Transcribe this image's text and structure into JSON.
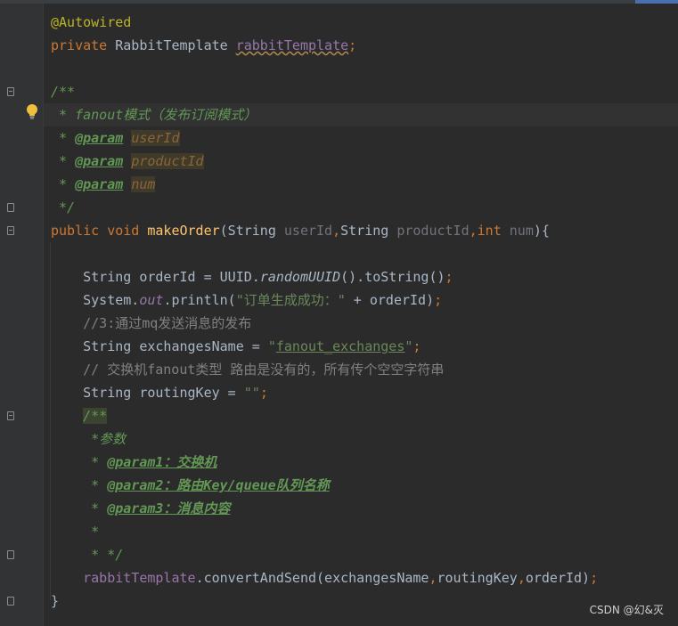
{
  "editor": {
    "lines": [
      {
        "spans": [
          {
            "t": "@Autowired",
            "c": "ann"
          }
        ]
      },
      {
        "spans": [
          {
            "t": "private ",
            "c": "kw"
          },
          {
            "t": "RabbitTemplate ",
            "c": ""
          },
          {
            "t": "rabbitTemplate",
            "c": "field wavy"
          },
          {
            "t": ";",
            "c": "kw"
          }
        ]
      },
      {
        "spans": []
      },
      {
        "spans": [
          {
            "t": "/**",
            "c": "doc"
          }
        ]
      },
      {
        "spans": [
          {
            "t": " * fanout模式（发布订阅模式）",
            "c": "doc"
          }
        ]
      },
      {
        "spans": [
          {
            "t": " * ",
            "c": "doc"
          },
          {
            "t": "@param",
            "c": "doctag"
          },
          {
            "t": " ",
            "c": "doc"
          },
          {
            "t": "userId",
            "c": "docval"
          }
        ]
      },
      {
        "spans": [
          {
            "t": " * ",
            "c": "doc"
          },
          {
            "t": "@param",
            "c": "doctag"
          },
          {
            "t": " ",
            "c": "doc"
          },
          {
            "t": "productId",
            "c": "docval"
          }
        ]
      },
      {
        "spans": [
          {
            "t": " * ",
            "c": "doc"
          },
          {
            "t": "@param",
            "c": "doctag"
          },
          {
            "t": " ",
            "c": "doc"
          },
          {
            "t": "num",
            "c": "docval"
          }
        ]
      },
      {
        "spans": [
          {
            "t": " */",
            "c": "doc"
          }
        ]
      },
      {
        "spans": [
          {
            "t": "public void ",
            "c": "kw"
          },
          {
            "t": "makeOrder",
            "c": "fn"
          },
          {
            "t": "(String ",
            "c": ""
          },
          {
            "t": "userId",
            "c": "param"
          },
          {
            "t": ",",
            "c": "kw"
          },
          {
            "t": "String ",
            "c": ""
          },
          {
            "t": "productId",
            "c": "param"
          },
          {
            "t": ",",
            "c": "kw"
          },
          {
            "t": "int ",
            "c": "kw"
          },
          {
            "t": "num",
            "c": "param"
          },
          {
            "t": "){",
            "c": ""
          }
        ]
      },
      {
        "spans": []
      },
      {
        "spans": [
          {
            "t": "    String orderId = UUID.",
            "c": ""
          },
          {
            "t": "randomUUID",
            "c": "static2"
          },
          {
            "t": "().toString()",
            "c": ""
          },
          {
            "t": ";",
            "c": "kw"
          }
        ]
      },
      {
        "spans": [
          {
            "t": "    System.",
            "c": ""
          },
          {
            "t": "out",
            "c": "static"
          },
          {
            "t": ".println(",
            "c": ""
          },
          {
            "t": "\"订单生成成功：\"",
            "c": "str"
          },
          {
            "t": " + orderId)",
            "c": ""
          },
          {
            "t": ";",
            "c": "kw"
          }
        ]
      },
      {
        "spans": [
          {
            "t": "    //3:通过mq发送消息的发布",
            "c": "cmt"
          }
        ]
      },
      {
        "spans": [
          {
            "t": "    String exchangesName = ",
            "c": ""
          },
          {
            "t": "\"",
            "c": "str"
          },
          {
            "t": "fanout_exchanges",
            "c": "str u"
          },
          {
            "t": "\"",
            "c": "str"
          },
          {
            "t": ";",
            "c": "kw"
          }
        ]
      },
      {
        "spans": [
          {
            "t": "    // 交换机fanout类型 路由是没有的，所有传个空空字符串",
            "c": "cmt"
          }
        ]
      },
      {
        "spans": [
          {
            "t": "    String routingKey = ",
            "c": ""
          },
          {
            "t": "\"\"",
            "c": "str"
          },
          {
            "t": ";",
            "c": "kw"
          }
        ]
      },
      {
        "spans": [
          {
            "t": "    ",
            "c": ""
          },
          {
            "t": "/**",
            "c": "doc bg-doc"
          }
        ]
      },
      {
        "spans": [
          {
            "t": "     *参数",
            "c": "doc"
          }
        ]
      },
      {
        "spans": [
          {
            "t": "     * ",
            "c": "doc"
          },
          {
            "t": "@param1：交换机",
            "c": "doctag"
          }
        ]
      },
      {
        "spans": [
          {
            "t": "     * ",
            "c": "doc"
          },
          {
            "t": "@param2：路由Key/queue队列名称",
            "c": "doctag"
          }
        ]
      },
      {
        "spans": [
          {
            "t": "     * ",
            "c": "doc"
          },
          {
            "t": "@param3：消息内容",
            "c": "doctag"
          }
        ]
      },
      {
        "spans": [
          {
            "t": "     *",
            "c": "doc"
          }
        ]
      },
      {
        "spans": [
          {
            "t": "     * */",
            "c": "doc"
          }
        ]
      },
      {
        "spans": [
          {
            "t": "    ",
            "c": ""
          },
          {
            "t": "rabbitTemplate",
            "c": "field"
          },
          {
            "t": ".convertAndSend(exchangesName",
            "c": ""
          },
          {
            "t": ",",
            "c": "kw"
          },
          {
            "t": "routingKey",
            "c": ""
          },
          {
            "t": ",",
            "c": "kw"
          },
          {
            "t": "orderId)",
            "c": ""
          },
          {
            "t": ";",
            "c": "kw"
          }
        ]
      },
      {
        "spans": [
          {
            "t": "}",
            "c": ""
          }
        ]
      }
    ]
  },
  "icons": {
    "intention": "lightbulb-icon",
    "fold": "fold-marker-icon"
  },
  "colors": {
    "background": "#2b2b2b",
    "keyword": "#cc7832",
    "annotation": "#bbb529",
    "field": "#9876aa",
    "method": "#ffc66d",
    "string": "#6a8759",
    "doc": "#629755",
    "comment": "#808080"
  },
  "watermark": "CSDN @幻&灭"
}
